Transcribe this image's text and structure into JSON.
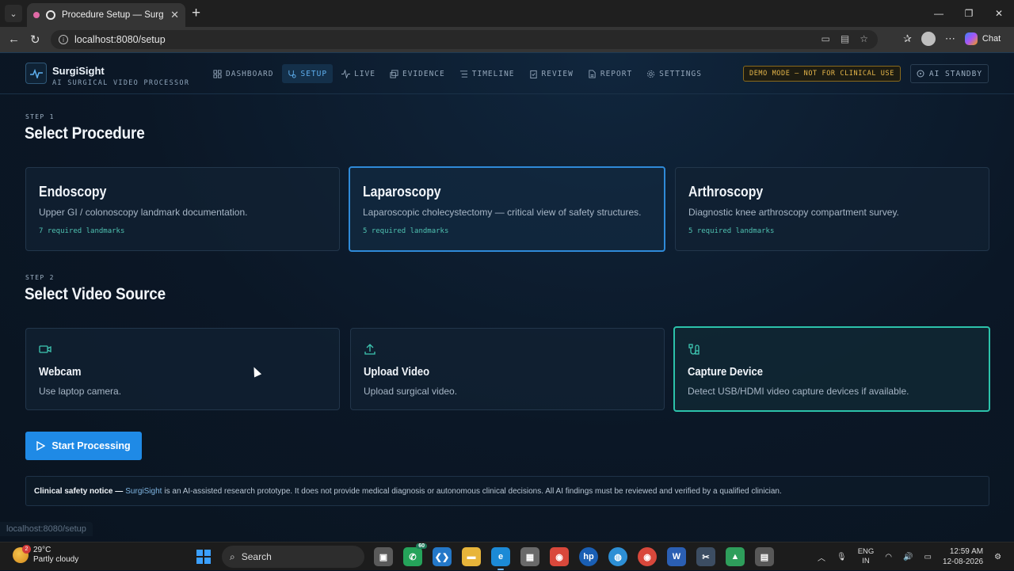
{
  "browser": {
    "tab_title": "Procedure Setup — SurgiSight",
    "url": "localhost:8080/setup",
    "chat_label": "Chat",
    "status_url": "localhost:8080/setup"
  },
  "header": {
    "brand_name": "SurgiSight",
    "brand_subtitle": "AI SURGICAL VIDEO PROCESSOR",
    "nav": [
      {
        "label": "DASHBOARD",
        "icon": "grid-icon"
      },
      {
        "label": "SETUP",
        "icon": "stethoscope-icon",
        "active": true
      },
      {
        "label": "LIVE",
        "icon": "activity-icon"
      },
      {
        "label": "EVIDENCE",
        "icon": "images-icon"
      },
      {
        "label": "TIMELINE",
        "icon": "list-icon"
      },
      {
        "label": "REVIEW",
        "icon": "clipboard-check-icon"
      },
      {
        "label": "REPORT",
        "icon": "file-icon"
      },
      {
        "label": "SETTINGS",
        "icon": "gear-icon"
      }
    ],
    "demo_badge": "DEMO MODE — NOT FOR CLINICAL USE",
    "standby_label": "AI STANDBY"
  },
  "step1": {
    "label": "STEP 1",
    "title": "Select Procedure",
    "procedures": [
      {
        "name": "Endoscopy",
        "description": "Upper GI / colonoscopy landmark documentation.",
        "meta": "7 required landmarks",
        "selected": false
      },
      {
        "name": "Laparoscopy",
        "description": "Laparoscopic cholecystectomy — critical view of safety structures.",
        "meta": "5 required landmarks",
        "selected": true
      },
      {
        "name": "Arthroscopy",
        "description": "Diagnostic knee arthroscopy compartment survey.",
        "meta": "5 required landmarks",
        "selected": false
      }
    ]
  },
  "step2": {
    "label": "STEP 2",
    "title": "Select Video Source",
    "sources": [
      {
        "name": "Webcam",
        "description": "Use laptop camera.",
        "icon": "video-camera-icon",
        "selected": false
      },
      {
        "name": "Upload Video",
        "description": "Upload surgical video.",
        "icon": "upload-icon",
        "selected": false
      },
      {
        "name": "Capture Device",
        "description": "Detect USB/HDMI video capture devices if available.",
        "icon": "cable-icon",
        "selected": true
      }
    ]
  },
  "actions": {
    "start_label": "Start Processing"
  },
  "notice": {
    "heading": "Clinical safety notice —",
    "brand": "SurgiSight",
    "text": "is an AI-assisted research prototype. It does not provide medical diagnosis or autonomous clinical decisions. All AI findings must be reviewed and verified by a qualified clinician."
  },
  "taskbar": {
    "temperature": "29°C",
    "condition": "Partly cloudy",
    "weather_badge": "2",
    "search_placeholder": "Search",
    "whatsapp_badge": "60",
    "lang_line1": "ENG",
    "lang_line2": "IN",
    "time": "12:59 AM",
    "date": "12-08-2026"
  },
  "colors": {
    "accent_blue": "#1f8ae6",
    "accent_teal": "#2cc2aa",
    "warning": "#e6b64a",
    "background": "#0b1624"
  }
}
